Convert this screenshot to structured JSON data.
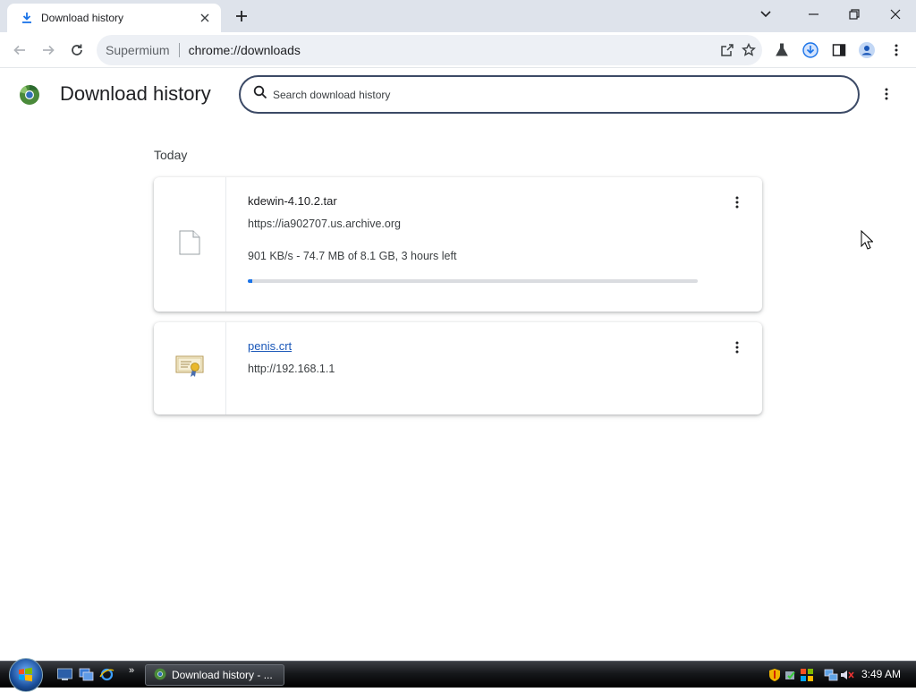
{
  "browser": {
    "tab": {
      "title": "Download history",
      "favicon": "download-icon"
    },
    "omnibox": {
      "site_label": "Supermium",
      "url": "chrome://downloads"
    }
  },
  "page": {
    "title": "Download history",
    "search": {
      "placeholder": "Search download history",
      "value": ""
    }
  },
  "downloads": {
    "section_label": "Today",
    "items": [
      {
        "file_name": "kdewin-4.10.2.tar",
        "source_url": "https://ia902707.us.archive.org",
        "status": "901 KB/s - 74.7 MB of 8.1 GB, 3 hours left",
        "progress_fraction": 0.009,
        "icon": "file-icon",
        "is_link": false
      },
      {
        "file_name": "penis.crt",
        "source_url": "http://192.168.1.1",
        "status": "",
        "icon": "certificate-icon",
        "is_link": true
      }
    ]
  },
  "taskbar": {
    "active_window_label": "Download history - ...",
    "clock": "3:49 AM"
  },
  "colors": {
    "accent": "#1a73e8",
    "tab_strip": "#dee3eb",
    "omnibox_bg": "#edf0f5",
    "search_border": "#3c4a66",
    "link": "#1a57b8"
  }
}
